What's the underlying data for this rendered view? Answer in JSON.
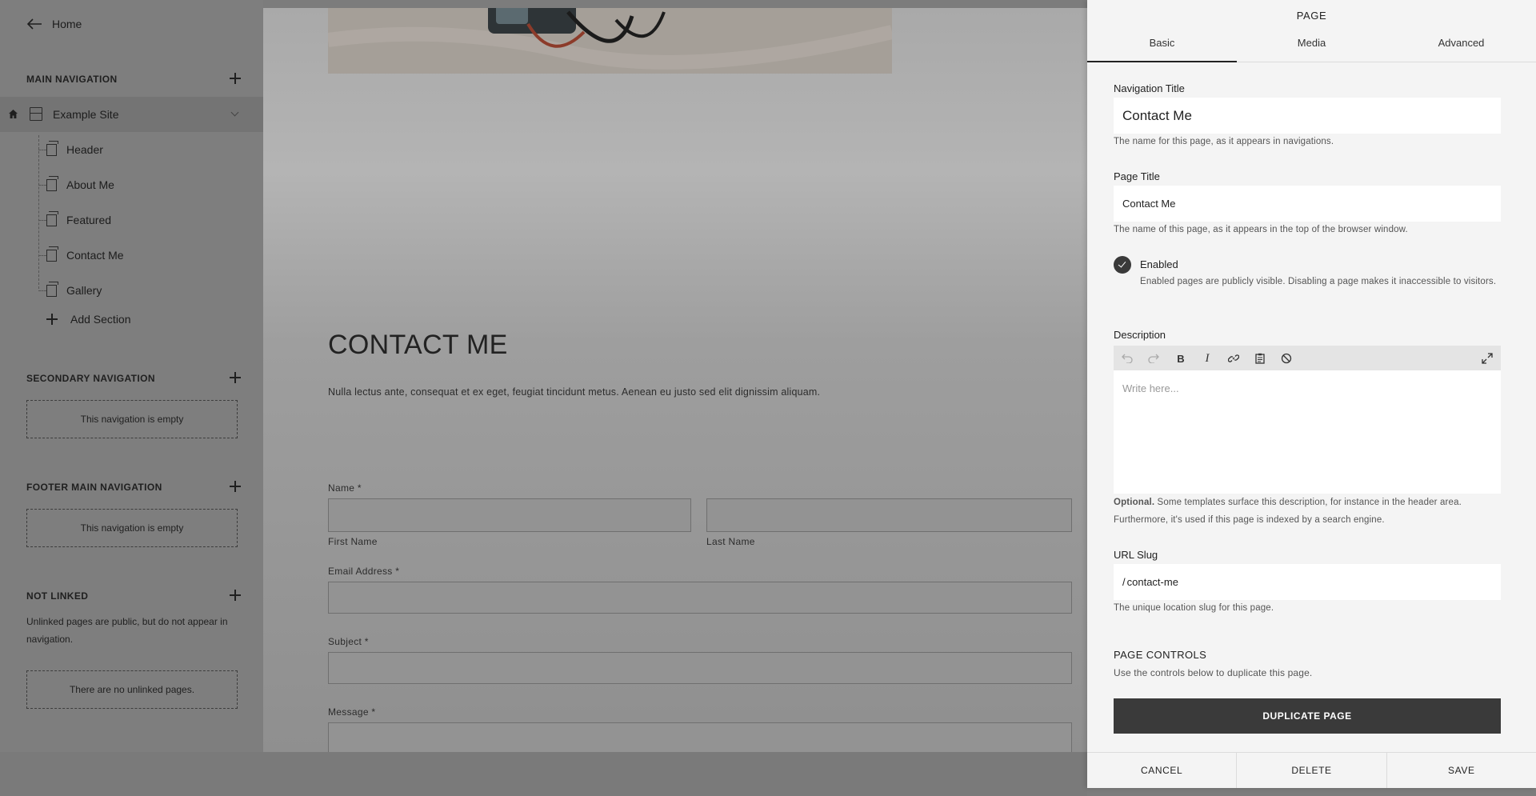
{
  "sidebar": {
    "home_label": "Home",
    "main_nav_title": "MAIN NAVIGATION",
    "site_label": "Example Site",
    "sections": [
      {
        "label": "Header"
      },
      {
        "label": "About Me"
      },
      {
        "label": "Featured"
      },
      {
        "label": "Contact Me"
      },
      {
        "label": "Gallery"
      }
    ],
    "add_section_label": "Add Section",
    "secondary_nav_title": "SECONDARY NAVIGATION",
    "secondary_empty": "This navigation is empty",
    "footer_nav_title": "FOOTER MAIN NAVIGATION",
    "footer_empty": "This navigation is empty",
    "not_linked_title": "NOT LINKED",
    "not_linked_desc": "Unlinked pages are public, but do not appear in navigation.",
    "not_linked_empty": "There are no unlinked pages."
  },
  "preview": {
    "title": "CONTACT ME",
    "description": "Nulla lectus ante, consequat et ex eget, feugiat tincidunt metus. Aenean eu justo sed elit dignissim aliquam.",
    "name_label": "Name *",
    "first_name_label": "First Name",
    "last_name_label": "Last Name",
    "email_label": "Email Address *",
    "subject_label": "Subject *",
    "message_label": "Message *"
  },
  "panel": {
    "header": "PAGE",
    "tabs": [
      "Basic",
      "Media",
      "Advanced"
    ],
    "nav_title_label": "Navigation Title",
    "nav_title_value": "Contact Me",
    "nav_title_hint": "The name for this page, as it appears in navigations.",
    "page_title_label": "Page Title",
    "page_title_value": "Contact Me",
    "page_title_hint": "The name of this page, as it appears in the top of the browser window.",
    "enabled_label": "Enabled",
    "enabled_hint": "Enabled pages are publicly visible. Disabling a page makes it inaccessible to visitors.",
    "description_label": "Description",
    "description_placeholder": "Write here...",
    "description_hint_bold": "Optional.",
    "description_hint": "Some templates surface this description, for instance in the header area. Furthermore, it's used if this page is indexed by a search engine.",
    "url_slug_label": "URL Slug",
    "url_slug_prefix": "/",
    "url_slug_value": "contact-me",
    "url_slug_hint": "The unique location slug for this page.",
    "page_controls_title": "PAGE CONTROLS",
    "page_controls_hint": "Use the controls below to duplicate this page.",
    "duplicate_label": "DUPLICATE PAGE",
    "cancel_label": "CANCEL",
    "delete_label": "DELETE",
    "save_label": "SAVE"
  }
}
